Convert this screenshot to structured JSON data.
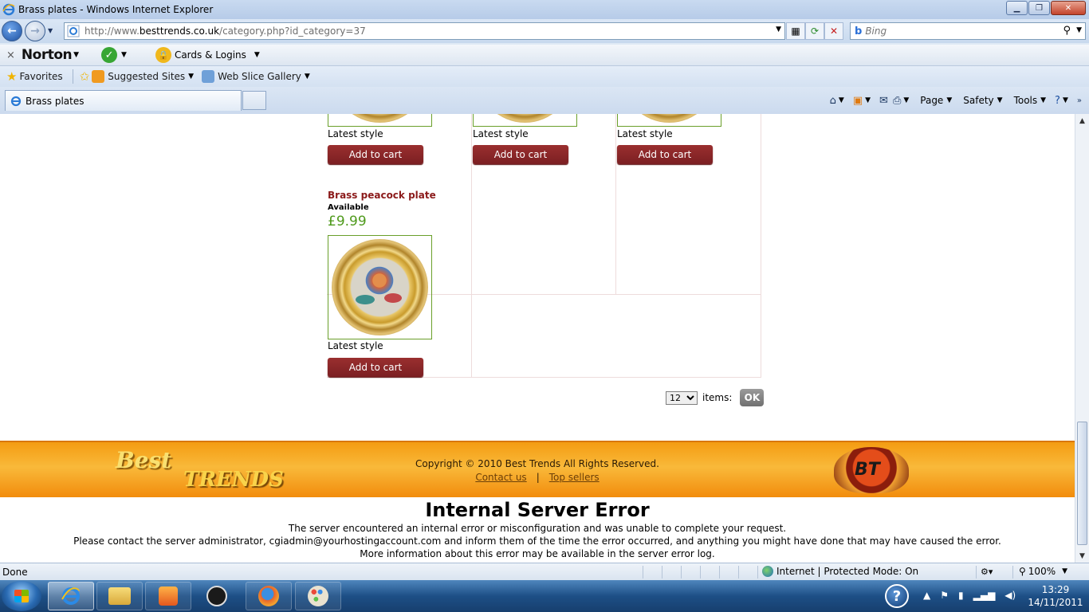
{
  "window": {
    "title": "Brass plates - Windows Internet Explorer",
    "min": "▁",
    "max": "❐",
    "close": "✕"
  },
  "address": {
    "url_prefix": "http://www.",
    "url_domain": "besttrends.co.uk",
    "url_path": "/category.php?id_category=37"
  },
  "search": {
    "placeholder": "Bing"
  },
  "norton": {
    "close": "×",
    "logo": "Norton",
    "cards_label": "Cards & Logins"
  },
  "favorites": {
    "favorites_label": "Favorites",
    "suggested_label": "Suggested Sites",
    "webslice_label": "Web Slice Gallery"
  },
  "tabs": {
    "active_label": "Brass plates"
  },
  "commands": {
    "page": "Page",
    "safety": "Safety",
    "tools": "Tools"
  },
  "products": {
    "top_row": [
      {
        "style": "Latest style",
        "cart": "Add to cart"
      },
      {
        "style": "Latest style",
        "cart": "Add to cart"
      },
      {
        "style": "Latest style",
        "cart": "Add to cart"
      }
    ],
    "item": {
      "name": "Brass peacock plate",
      "availability": "Available",
      "price": "£9.99",
      "style": "Latest style",
      "cart": "Add to cart"
    }
  },
  "pager": {
    "value": "12",
    "items_label": "items:",
    "ok_label": "OK"
  },
  "footer": {
    "logo_line1": "Best",
    "logo_line2": "TRENDS",
    "copyright": "Copyright © 2010 Best Trends All Rights Reserved.",
    "contact": "Contact us",
    "separator": "|",
    "top_sellers": "Top sellers",
    "bt_logo": "BT"
  },
  "error": {
    "title": "Internal Server Error",
    "line1": "The server encountered an internal error or misconfiguration and was unable to complete your request.",
    "line2": "Please contact the server administrator, cgiadmin@yourhostingaccount.com and inform them of the time the error occurred, and anything you might have done that may have caused the error.",
    "line3": "More information about this error may be available in the server error log."
  },
  "status": {
    "done": "Done",
    "zone": "Internet | Protected Mode: On",
    "zoom": "100%"
  },
  "taskbar": {
    "time": "13:29",
    "date": "14/11/2011"
  },
  "colors": {
    "accent_red": "#8b1a1a",
    "price_green": "#4f9a1c",
    "footer_orange": "#f49c12"
  }
}
